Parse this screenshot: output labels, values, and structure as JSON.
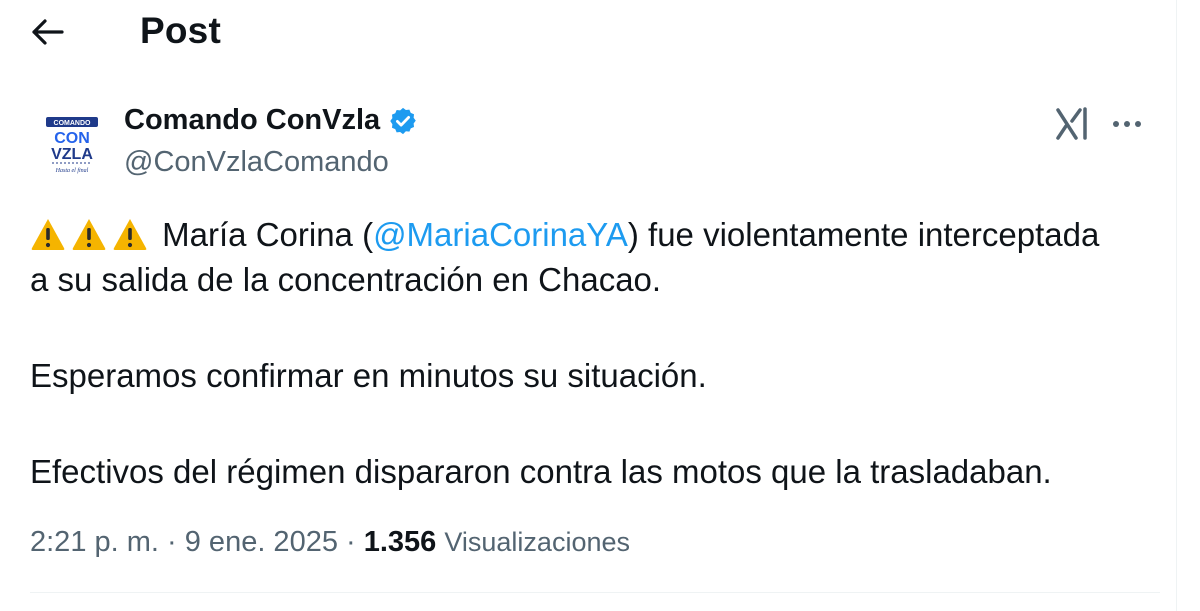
{
  "header": {
    "title": "Post"
  },
  "author": {
    "name": "Comando ConVzla",
    "handle": "@ConVzlaComando",
    "avatar_text": {
      "top": "COMANDO",
      "line1": "CON",
      "line2": "VZLA",
      "tagline": "Hasta el final"
    }
  },
  "tweet": {
    "line1_prefix": " María Corina (",
    "mention": "@MariaCorinaYA",
    "line1_suffix": ") fue violentamente interceptada",
    "line2": "a su salida de la concentración en Chacao.",
    "paragraph2": "Esperamos confirmar en minutos su situación.",
    "paragraph3": "Efectivos del régimen dispararon contra las motos que la trasladaban."
  },
  "meta": {
    "time": "2:21 p. m.",
    "separator": " · ",
    "date": "9 ene. 2025",
    "views_count": "1.356",
    "views_label": "Visualizaciones"
  },
  "colors": {
    "accent": "#1d9bf0",
    "text": "#0f1419",
    "secondary": "#536471",
    "avatar_navy": "#1f3a8a"
  },
  "icons": {
    "back": "arrow-left-icon",
    "verified": "verified-badge-icon",
    "grok": "grok-icon",
    "more": "more-horizontal-icon",
    "warning": "warning-icon"
  }
}
